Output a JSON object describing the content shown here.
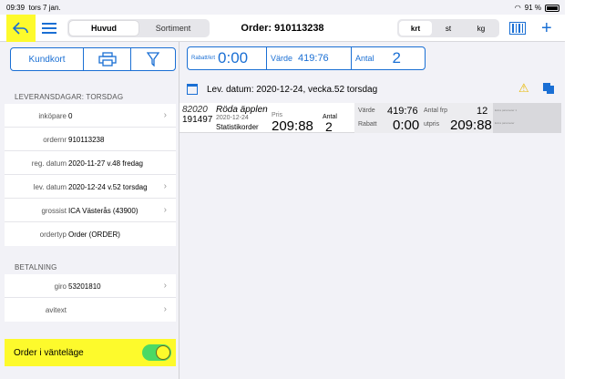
{
  "status_bar": {
    "time": "09:39",
    "date": "tors 7 jan.",
    "battery": "91 %"
  },
  "header": {
    "back_icon": "back-arrow-icon",
    "menu_icon": "menu-icon",
    "segments": [
      "Huvud",
      "Sortiment"
    ],
    "active_segment": "Huvud",
    "title": "Order: 910113238",
    "units": [
      "krt",
      "st",
      "kg"
    ],
    "active_unit": "krt",
    "barcode_icon": "barcode-icon",
    "add_icon": "plus-icon"
  },
  "sidebar": {
    "buttons": {
      "kundkort": "Kundkort",
      "print_icon": "printer-icon",
      "filter_icon": "filter-icon"
    },
    "leverans_header": "LEVERANSDAGAR: TORSDAG",
    "rows": [
      {
        "label": "inköpare",
        "value": "0",
        "chevron": true
      },
      {
        "label": "ordernr",
        "value": "910113238",
        "chevron": false
      },
      {
        "label": "reg. datum",
        "value": "2020-11-27 v.48   fredag",
        "chevron": false
      },
      {
        "label": "lev. datum",
        "value": "2020-12-24 v.52  torsdag",
        "chevron": true
      },
      {
        "label": "grossist",
        "value": "ICA Västerås (43900)",
        "chevron": true
      },
      {
        "label": "ordertyp",
        "value": "Order (ORDER)",
        "chevron": false
      }
    ],
    "betalning_header": "BETALNING",
    "pay_rows": [
      {
        "label": "giro",
        "value": "53201810",
        "chevron": true
      },
      {
        "label": "avitext",
        "value": "",
        "chevron": true
      }
    ],
    "toggle": {
      "label": "Order i vänteläge",
      "on": true
    }
  },
  "totals": {
    "rabatt_label": "Rabatt/krt",
    "rabatt_value": "0:00",
    "varde_label": "Värde",
    "varde_value": "419:76",
    "antal_label": "Antal",
    "antal_value": "2"
  },
  "lev_datum_text": "Lev. datum: 2020-12-24, vecka.52  torsdag",
  "icons": {
    "calendar": "calendar-icon",
    "warning": "warning-icon",
    "copy": "copy-icon"
  },
  "item": {
    "nr1": "82020",
    "nr2": "191497",
    "name": "Röda äpplen",
    "date": "2020-12-24",
    "stat": "Statistikorder",
    "pris_label": "Pris",
    "pris": "209:88",
    "antal_label": "Antal",
    "antal": "2",
    "varde_label": "Värde",
    "varde": "419:76",
    "rabatt_label": "Rabatt",
    "rabatt": "0:00",
    "antal_frp_label": "Antal frp",
    "antal_frp": "12",
    "utpris_label": "utpris",
    "utpris": "209:88",
    "extra1": "Extra parameter 1",
    "extra2": "Extra parameter"
  },
  "colors": {
    "accent": "#1a6fd4",
    "highlight": "#fdfa2c",
    "toggle_on": "#4cd964"
  }
}
